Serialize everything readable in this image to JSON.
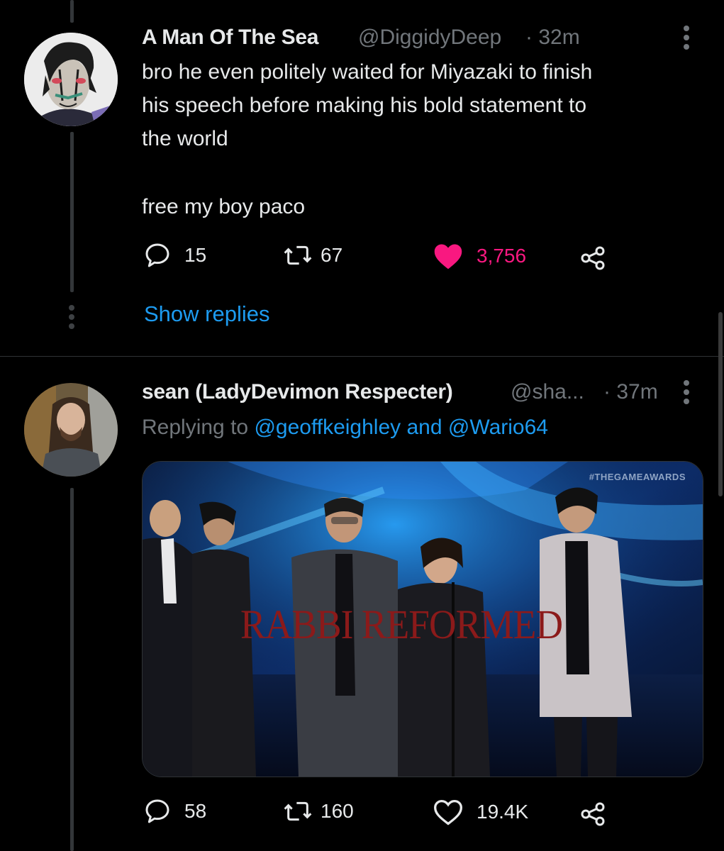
{
  "tweet1": {
    "display_name": "A Man Of The Sea",
    "handle": "@DiggidyDeep",
    "time": "· 32m",
    "lines": [
      "bro he even politely waited for Miyazaki to finish",
      "his speech before making his bold statement to",
      "the world"
    ],
    "line2": "free my boy paco",
    "reply_count": "15",
    "retweet_count": "67",
    "like_count": "3,756",
    "liked": true,
    "show_replies": "Show replies"
  },
  "tweet2": {
    "display_name": "sean (LadyDevimon Respecter)",
    "handle": "@sha...",
    "time": "· 37m",
    "replying_to_prefix": "Replying to",
    "replying_to_user1": "@geoffkeighley",
    "replying_to_and": "and",
    "replying_to_user2": "@Wario64",
    "media": {
      "watermark": "#THEGAMEAWARDS",
      "caption": "RABBI REFORMED"
    },
    "reply_count": "58",
    "retweet_count": "160",
    "like_count": "19.4K",
    "liked": false
  },
  "colors": {
    "background": "#000000",
    "text": "#e7e9ea",
    "muted": "#71767b",
    "link": "#1d9bf0",
    "like": "#f91880",
    "caption": "#8b1a1a"
  },
  "icons": [
    "more-icon",
    "reply-icon",
    "retweet-icon",
    "like-icon",
    "share-icon"
  ]
}
